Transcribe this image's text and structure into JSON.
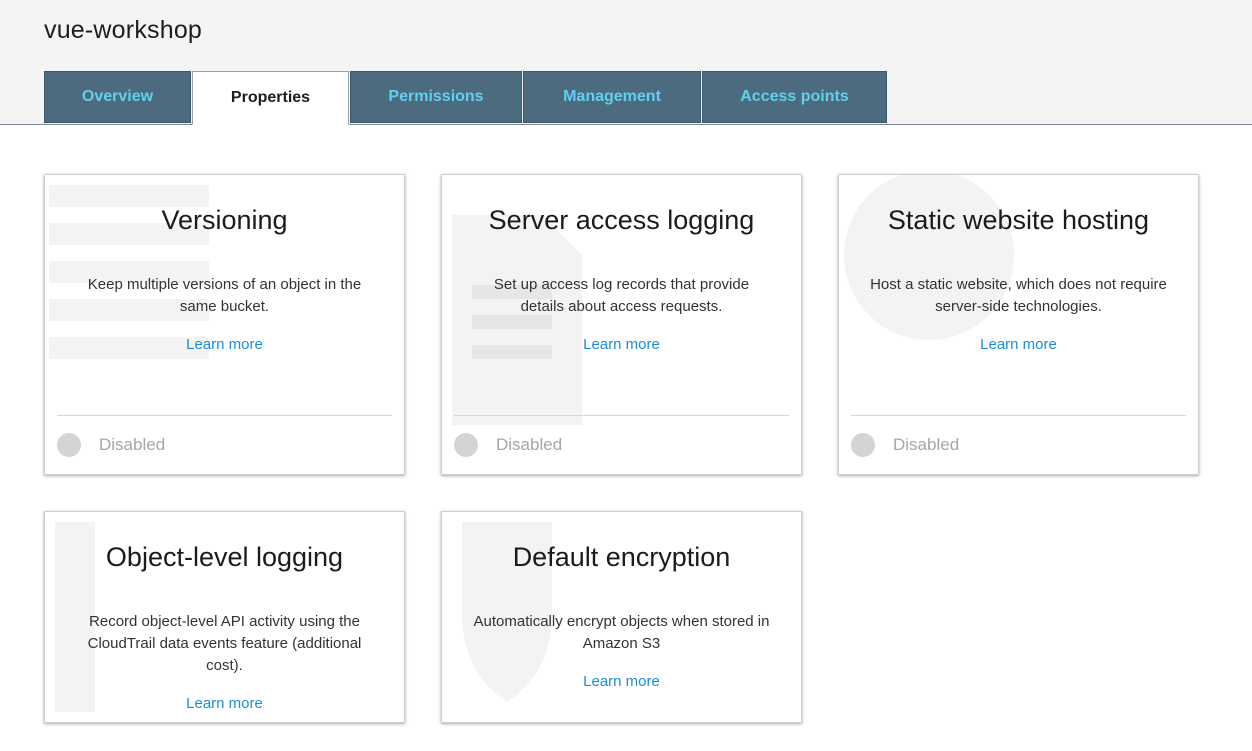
{
  "page": {
    "bucket_name": "vue-workshop"
  },
  "tabs": [
    {
      "label": "Overview",
      "active": false
    },
    {
      "label": "Properties",
      "active": true
    },
    {
      "label": "Permissions",
      "active": false
    },
    {
      "label": "Management",
      "active": false
    },
    {
      "label": "Access points",
      "active": false
    }
  ],
  "cards": [
    {
      "title": "Versioning",
      "description": "Keep multiple versions of an object in the same bucket.",
      "learn_more": "Learn more",
      "status": "Disabled"
    },
    {
      "title": "Server access logging",
      "description": "Set up access log records that provide details about access requests.",
      "learn_more": "Learn more",
      "status": "Disabled"
    },
    {
      "title": "Static website hosting",
      "description": "Host a static website, which does not require server-side technologies.",
      "learn_more": "Learn more",
      "status": "Disabled"
    },
    {
      "title": "Object-level logging",
      "description": "Record object-level API activity using the CloudTrail data events feature (additional cost).",
      "learn_more": "Learn more"
    },
    {
      "title": "Default encryption",
      "description": "Automatically encrypt objects when stored in Amazon S3",
      "learn_more": "Learn more"
    }
  ],
  "colors": {
    "tab_bg": "#4c6b7f",
    "tab_text": "#5fd0ee",
    "link": "#1a8fd6",
    "disabled_text": "#a6a6a6"
  }
}
